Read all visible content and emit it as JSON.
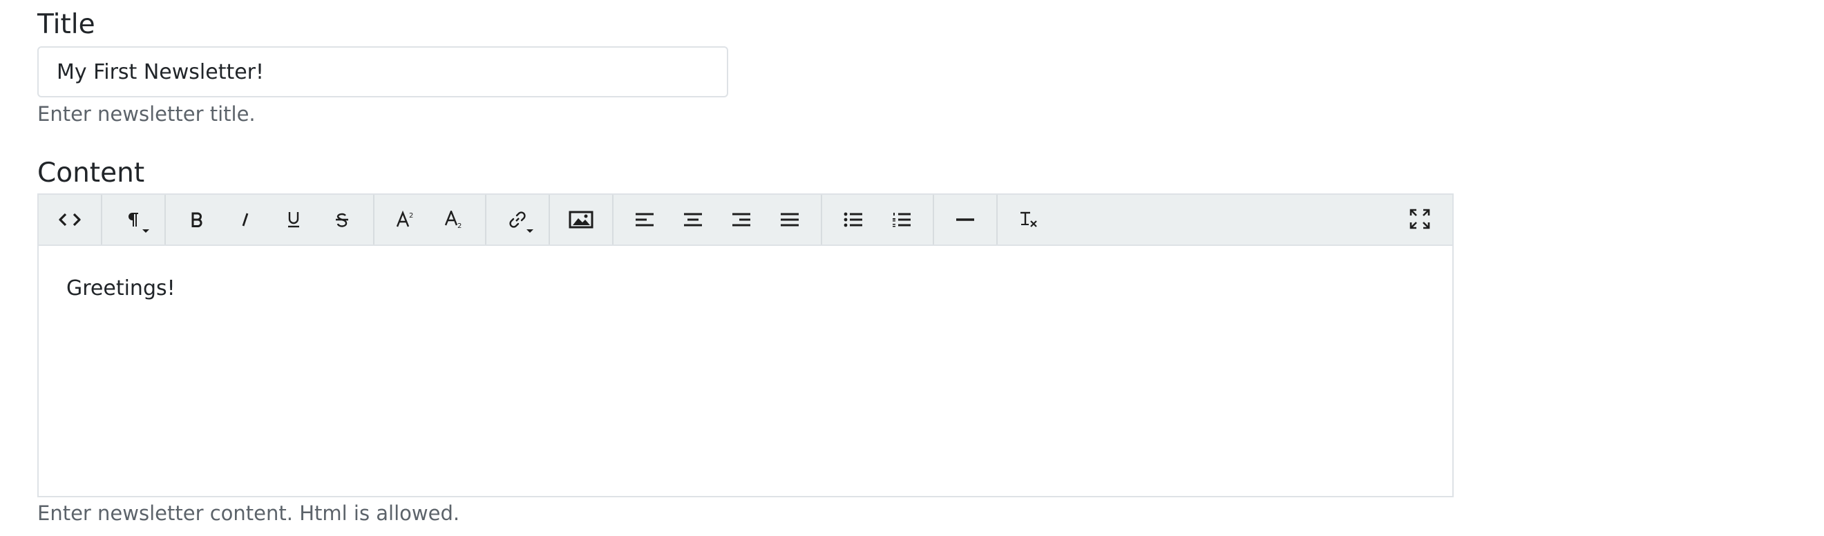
{
  "title_field": {
    "label": "Title",
    "value": "My First Newsletter!",
    "help": "Enter newsletter title."
  },
  "content_field": {
    "label": "Content",
    "body_text": "Greetings!",
    "help": "Enter newsletter content. Html is allowed."
  },
  "toolbar": {
    "icons": [
      "code-view-icon",
      "paragraph-style-icon",
      "bold-icon",
      "italic-icon",
      "underline-icon",
      "strikethrough-icon",
      "superscript-icon",
      "subscript-icon",
      "link-icon",
      "image-icon",
      "align-left-icon",
      "align-center-icon",
      "align-right-icon",
      "align-justify-icon",
      "bulleted-list-icon",
      "numbered-list-icon",
      "horizontal-rule-icon",
      "clear-formatting-icon",
      "fullscreen-icon"
    ],
    "background": "#ebeff0"
  },
  "colors": {
    "border": "#dee2e6",
    "text": "#212529",
    "help_text": "#5c636a"
  }
}
